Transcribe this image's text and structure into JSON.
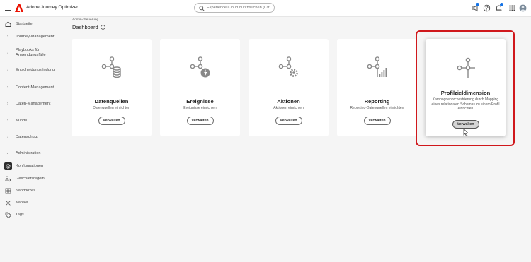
{
  "topbar": {
    "app_title": "Adobe Journey Optimizer",
    "search_placeholder": "Experience Cloud durchsuchen (Ctr...",
    "brand_color": "#eb1000"
  },
  "sidebar": {
    "items": [
      {
        "label": "Startseite",
        "icon": "home-icon"
      },
      {
        "label": "Journey-Management",
        "icon": "chevron-right-icon"
      },
      {
        "label": "Playbooks für Anwendungsfälle",
        "icon": "chevron-right-icon"
      },
      {
        "label": "Entscheidungsfindung",
        "icon": "chevron-right-icon"
      },
      {
        "label": "Content-Management",
        "icon": "chevron-right-icon"
      },
      {
        "label": "Daten-Management",
        "icon": "chevron-right-icon"
      },
      {
        "label": "Kunde",
        "icon": "chevron-right-icon"
      },
      {
        "label": "Datenschutz",
        "icon": "chevron-right-icon"
      },
      {
        "label": "Administration",
        "icon": "chevron-down-icon"
      },
      {
        "label": "Konfigurationen",
        "icon": "gear-icon"
      },
      {
        "label": "Geschäftsregeln",
        "icon": "rules-icon"
      },
      {
        "label": "Sandboxes",
        "icon": "sandbox-icon"
      },
      {
        "label": "Kanäle",
        "icon": "channels-icon"
      },
      {
        "label": "Tags",
        "icon": "tag-icon"
      }
    ]
  },
  "content": {
    "breadcrumb": "Admin-Steuerung",
    "page_title": "Dashboard"
  },
  "cards": [
    {
      "title": "Datenquellen",
      "description": "Datenquellen einrichten",
      "button": "Verwalten"
    },
    {
      "title": "Ereignisse",
      "description": "Ereignisse einrichten",
      "button": "Verwalten"
    },
    {
      "title": "Aktionen",
      "description": "Aktionen einrichten",
      "button": "Verwalten"
    },
    {
      "title": "Reporting",
      "description": "Reporting-Datenquellen einrichten",
      "button": "Verwalten"
    },
    {
      "title": "Profilzieldimension",
      "description": "Kampagnenorchestrierung durch Mapping eines relationalen Schemas zu einem Profil einrichten",
      "button": "Verwalten"
    }
  ],
  "highlight_color": "#d0181c"
}
